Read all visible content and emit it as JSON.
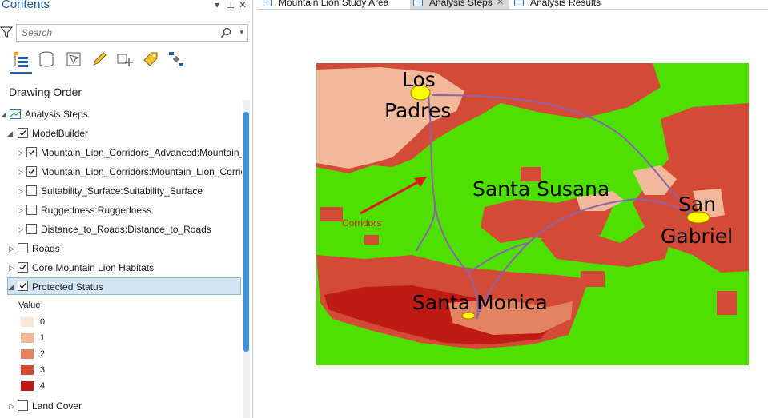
{
  "pane": {
    "title": "Contents",
    "pin_glyph": "▾",
    "autohide_glyph": "⊥",
    "close_glyph": "✕",
    "search": {
      "placeholder": "Search"
    },
    "section_title": "Drawing Order",
    "map_name": "Analysis Steps",
    "layers": [
      {
        "label": "ModelBuilder",
        "checked": true,
        "expanded": true
      },
      {
        "label": "Mountain_Lion_Corridors_Advanced:Mountain_Lion_Corridors_Advanced",
        "checked": true,
        "expanded": false
      },
      {
        "label": "Mountain_Lion_Corridors:Mountain_Lion_Corridors",
        "checked": true,
        "expanded": false
      },
      {
        "label": "Suitability_Surface:Suitability_Surface",
        "checked": false,
        "expanded": false
      },
      {
        "label": "Ruggedness:Ruggedness",
        "checked": false,
        "expanded": false
      },
      {
        "label": "Distance_to_Roads:Distance_to_Roads",
        "checked": false,
        "expanded": false
      },
      {
        "label": "Roads",
        "checked": false,
        "expanded": false
      },
      {
        "label": "Core Mountain Lion Habitats",
        "checked": true,
        "expanded": false
      },
      {
        "label": "Protected Status",
        "checked": true,
        "expanded": true,
        "selected": true
      },
      {
        "label": "Land Cover",
        "checked": false,
        "expanded": false
      }
    ],
    "legend": {
      "heading": "Value",
      "items": [
        {
          "label": "0",
          "color": "#fde6d6"
        },
        {
          "label": "1",
          "color": "#f2b89a"
        },
        {
          "label": "2",
          "color": "#e4835f"
        },
        {
          "label": "3",
          "color": "#d34a36"
        },
        {
          "label": "4",
          "color": "#c01a14"
        }
      ]
    }
  },
  "tabs": [
    {
      "label": "Mountain Lion Study Area",
      "active": false
    },
    {
      "label": "Analysis Steps",
      "active": true,
      "close_glyph": "✕"
    },
    {
      "label": "Analysis Results",
      "active": false
    }
  ],
  "map": {
    "labels": {
      "los_padres_1": "Los",
      "los_padres_2": "Padres",
      "santa_susana": "Santa Susana",
      "san_gabriel_1": "San",
      "san_gabriel_2": "Gabriel",
      "santa_monica": "Santa Monica",
      "corridors": "Corridors"
    },
    "colors": {
      "background_green": "#4fe000",
      "corridor": "#8c63a8",
      "arrow": "#e0161b",
      "habitat_core": "#ffff00"
    }
  }
}
